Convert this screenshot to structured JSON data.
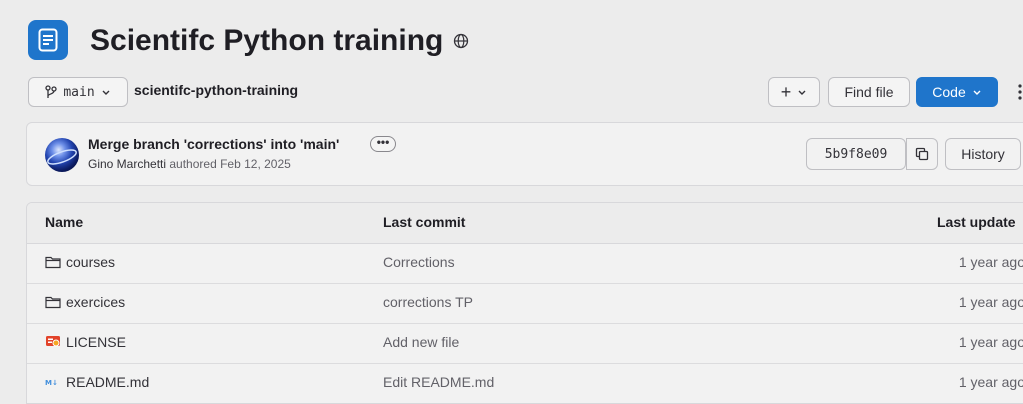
{
  "project": {
    "title": "Scientifc Python training",
    "visibility_icon": "globe-icon"
  },
  "toolbar": {
    "branch": "main",
    "path": "scientifc-python-training",
    "add_label": "+",
    "find_file_label": "Find file",
    "code_label": "Code"
  },
  "last_commit": {
    "message": "Merge branch 'corrections' into 'main'",
    "author": "Gino Marchetti",
    "authored_text": "authored",
    "date": "Feb 12, 2025",
    "sha": "5b9f8e09",
    "history_label": "History"
  },
  "files_table": {
    "columns": [
      "Name",
      "Last commit",
      "Last update"
    ],
    "rows": [
      {
        "name": "courses",
        "icon": "folder-icon",
        "commit": "Corrections",
        "updated": "1 year ago"
      },
      {
        "name": "exercices",
        "icon": "folder-icon",
        "commit": "corrections TP",
        "updated": "1 year ago"
      },
      {
        "name": "LICENSE",
        "icon": "license-icon",
        "commit": "Add new file",
        "updated": "1 year ago"
      },
      {
        "name": "README.md",
        "icon": "markdown-icon",
        "commit": "Edit README.md",
        "updated": "1 year ago"
      }
    ]
  },
  "colors": {
    "primary": "#1f75cb",
    "license_icon": "#e2432a"
  }
}
